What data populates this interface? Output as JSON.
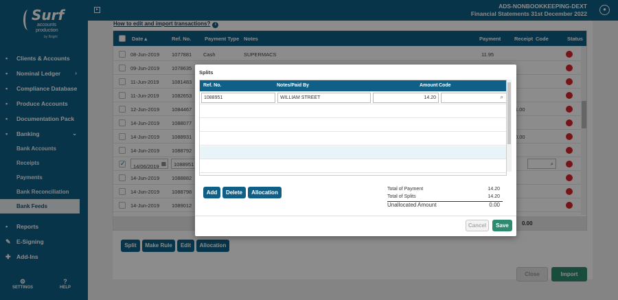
{
  "brand": {
    "name": "Surf",
    "line1": "accounts",
    "line2": "production",
    "line3": "by Bright"
  },
  "topbar": {
    "client": "ADS-NONBOOKKEEPING-DEXT",
    "period": "Financial Statements 31st December 2022"
  },
  "nav": [
    {
      "label": "Clients & Accounts",
      "icon": "users-icon",
      "glyph": "▪"
    },
    {
      "label": "Nominal Ledger",
      "icon": "ledger-icon",
      "glyph": "▪",
      "chevron": "›"
    },
    {
      "label": "Compliance Database",
      "icon": "database-icon",
      "glyph": "▪"
    },
    {
      "label": "Produce Accounts",
      "icon": "document-icon",
      "glyph": "▪"
    },
    {
      "label": "Documentation Pack",
      "icon": "folder-icon",
      "glyph": "▪"
    },
    {
      "label": "Banking",
      "icon": "bank-icon",
      "glyph": "▪",
      "chevron": "⌄"
    }
  ],
  "banking_sub": [
    "Bank Accounts",
    "Receipts",
    "Payments",
    "Bank Reconciliation",
    "Bank Feeds"
  ],
  "nav2": [
    {
      "label": "Reports",
      "icon": "reports-icon",
      "glyph": "▪"
    },
    {
      "label": "E-Signing",
      "icon": "signing-icon",
      "glyph": "✎"
    },
    {
      "label": "Add-Ins",
      "icon": "addins-icon",
      "glyph": "✚"
    }
  ],
  "side_bottom": {
    "settings": "SETTINGS",
    "help": "HELP"
  },
  "howto": "How to edit and import transactions?",
  "grid": {
    "headers": {
      "date": "Date ▴",
      "ref": "Ref. No.",
      "ptype": "Payment Type",
      "notes": "Notes",
      "payment": "Payment",
      "receipt": "Receipt",
      "code": "Code",
      "status": "Status"
    },
    "rows": [
      {
        "date": "08-Jun-2019",
        "ref": "1077881",
        "ptype": "Cash",
        "notes": "SUPERMACS",
        "payment": "11.95",
        "receipt": ""
      },
      {
        "date": "09-Jun-2019",
        "ref": "1078635",
        "ptype": "",
        "notes": "",
        "payment": "",
        "receipt": ""
      },
      {
        "date": "11-Jun-2019",
        "ref": "1081483",
        "ptype": "",
        "notes": "",
        "payment": "",
        "receipt": ""
      },
      {
        "date": "11-Jun-2019",
        "ref": "1082653",
        "ptype": "",
        "notes": "",
        "payment": "",
        "receipt": ""
      },
      {
        "date": "12-Jun-2019",
        "ref": "1084467",
        "ptype": "",
        "notes": "",
        "payment": "",
        "receipt": "1.00"
      },
      {
        "date": "14-Jun-2019",
        "ref": "1088077",
        "ptype": "",
        "notes": "",
        "payment": "",
        "receipt": ""
      },
      {
        "date": "14-Jun-2019",
        "ref": "1088931",
        "ptype": "",
        "notes": "",
        "payment": "",
        "receipt": "0.00"
      },
      {
        "date": "14-Jun-2019",
        "ref": "1088792",
        "ptype": "",
        "notes": "",
        "payment": "",
        "receipt": ""
      },
      {
        "date": "14/06/2019",
        "ref": "1088951",
        "ptype": "",
        "notes": "",
        "payment": "",
        "receipt": "",
        "editing": true
      },
      {
        "date": "14-Jun-2019",
        "ref": "1088882",
        "ptype": "",
        "notes": "",
        "payment": "",
        "receipt": ""
      },
      {
        "date": "14-Jun-2019",
        "ref": "1088798",
        "ptype": "",
        "notes": "",
        "payment": "",
        "receipt": ""
      },
      {
        "date": "14-Jun-2019",
        "ref": "1089012",
        "ptype": "",
        "notes": "",
        "payment": "",
        "receipt": ""
      }
    ],
    "footer_total": "0.00"
  },
  "actions": {
    "split": "Split",
    "make_rule": "Make Rule",
    "edit": "Edit",
    "allocation": "Allocation",
    "close": "Close",
    "import": "Import"
  },
  "splits": {
    "title": "Splits",
    "headers": {
      "ref": "Ref. No.",
      "notes": "Notes/Paid By",
      "amount": "Amount",
      "code": "Code"
    },
    "row": {
      "ref": "1088951",
      "notes": "WILLIAM STREET",
      "amount": "14.20",
      "code": ""
    },
    "buttons": {
      "add": "Add",
      "delete": "Delete",
      "allocation": "Allocation",
      "cancel": "Cancel",
      "save": "Save"
    },
    "totals": [
      {
        "label": "Total of Payment",
        "value": "14.20"
      },
      {
        "label": "Total of Splits",
        "value": "14.20"
      },
      {
        "label": "Unallocated Amount",
        "value": "0.00"
      }
    ]
  }
}
